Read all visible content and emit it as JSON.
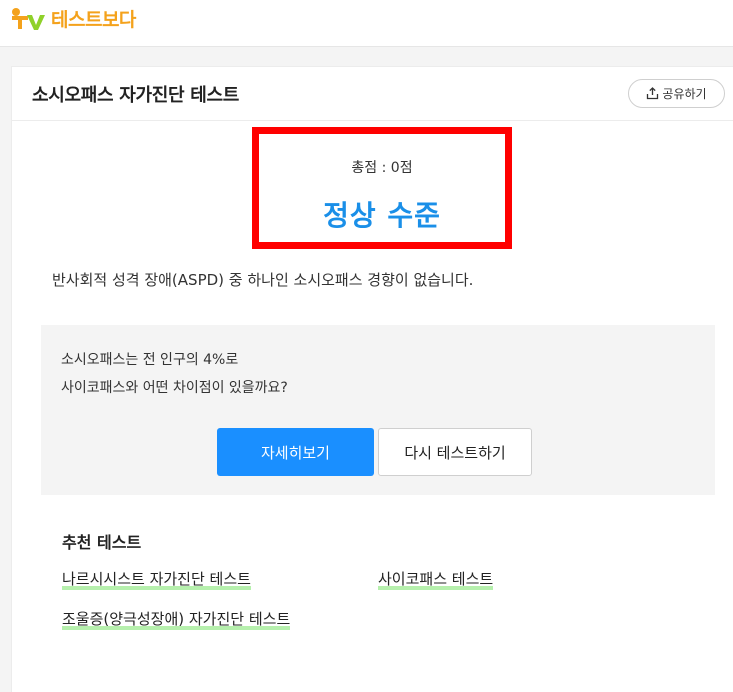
{
  "header": {
    "logo_text": "테스트보다",
    "logo_mark": "TV"
  },
  "card": {
    "title": "소시오패스 자가진단 테스트",
    "share_label": "공유하기"
  },
  "result": {
    "score_text": "총점 : 0점",
    "level": "정상 수준",
    "description": "반사회적 성격 장애(ASPD) 중 하나인 소시오패스 경향이 없습니다."
  },
  "info": {
    "line1": "소시오패스는 전 인구의 4%로",
    "line2": "사이코패스와 어떤 차이점이 있을까요?",
    "details_button": "자세히보기",
    "retry_button": "다시 테스트하기"
  },
  "recommended": {
    "title": "추천 테스트",
    "links": [
      "나르시시스트 자가진단 테스트",
      "사이코패스 테스트",
      "조울증(양극성장애) 자가진단 테스트"
    ]
  },
  "colors": {
    "accent_blue": "#1a8fff",
    "result_blue": "#1a8fe8",
    "highlight_red": "#ff0000",
    "logo_orange": "#f4a21c",
    "link_underline": "#b6f0ad"
  }
}
